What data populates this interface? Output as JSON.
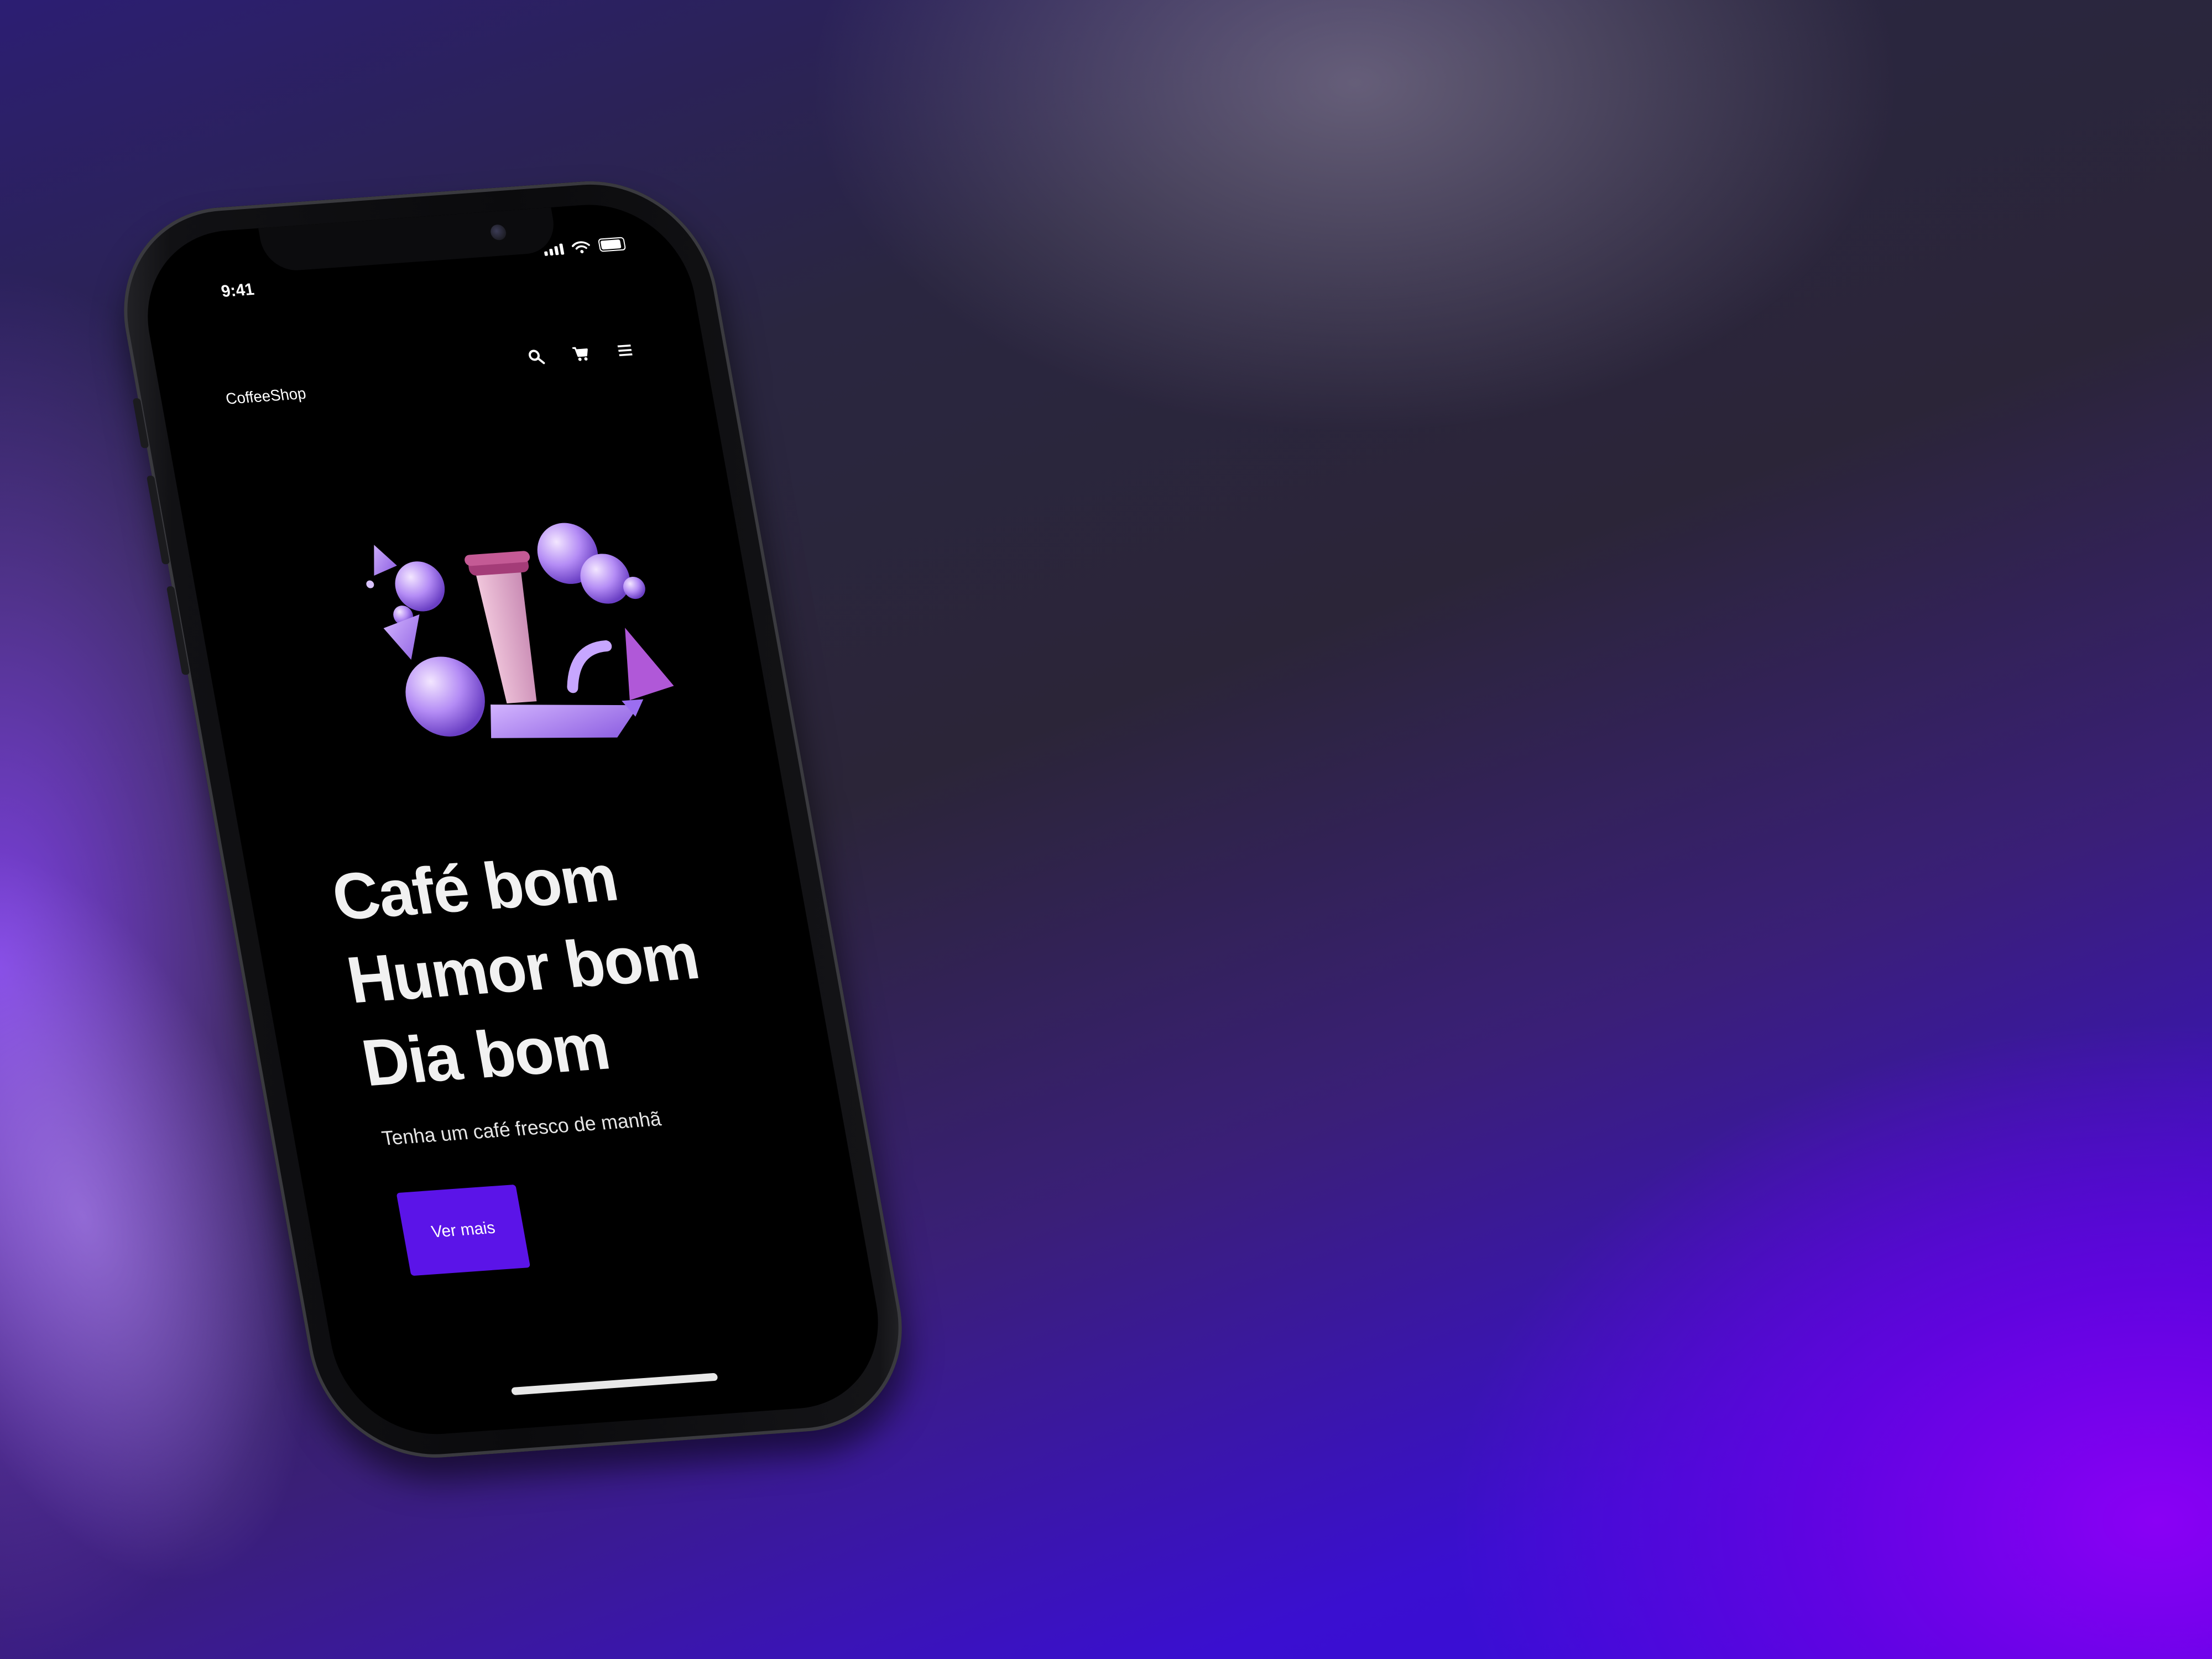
{
  "status_bar": {
    "time": "9:41"
  },
  "app": {
    "brand": "CoffeeShop"
  },
  "nav": {
    "icons": [
      "search-icon",
      "cart-icon",
      "menu-icon"
    ]
  },
  "hero": {
    "line1": "Café bom",
    "line2": "Humor bom",
    "line3": "Dia bom",
    "subtitle": "Tenha um café fresco de manhã",
    "cta_label": "Ver mais"
  },
  "colors": {
    "accent": "#5b14e8",
    "screen_bg": "#000000",
    "text": "#f1f1f1"
  }
}
